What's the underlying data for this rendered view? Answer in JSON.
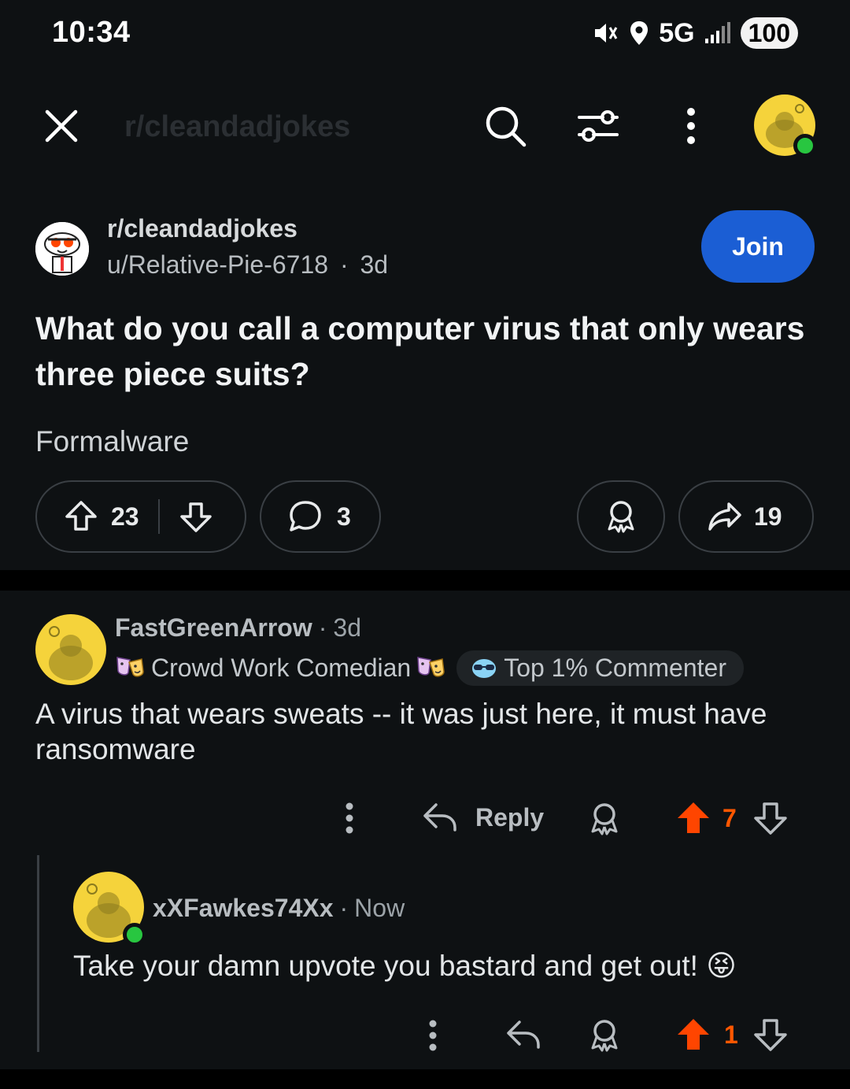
{
  "status_bar": {
    "time": "10:34",
    "network": "5G",
    "battery": "100"
  },
  "header": {
    "subreddit_faded": "r/cleandadjokes"
  },
  "post": {
    "subreddit": "r/cleandadjokes",
    "author": "u/Relative-Pie-6718",
    "age": "3d",
    "join_label": "Join",
    "title": "What do you call a computer virus that only wears three piece suits?",
    "body": "Formalware",
    "upvotes": "23",
    "comments": "3",
    "shares": "19"
  },
  "comments": [
    {
      "author": "FastGreenArrow",
      "age": "3d",
      "flair": "Crowd Work Comedian",
      "badge": "Top 1% Commenter",
      "text": "A virus that wears sweats -- it was just here, it must have ransomware",
      "reply_label": "Reply",
      "score": "7"
    },
    {
      "author": "xXFawkes74Xx",
      "age": "Now",
      "text": "Take your damn upvote you bastard and get out! 😝",
      "score": "1"
    }
  ],
  "colors": {
    "upvote_active": "#ff5700",
    "join": "#1b5ed4",
    "online": "#28c640"
  },
  "icons": [
    "close-icon",
    "search-icon",
    "filter-icon",
    "more-icon",
    "upvote-icon",
    "downvote-icon",
    "comment-icon",
    "award-icon",
    "share-icon",
    "reply-icon"
  ]
}
